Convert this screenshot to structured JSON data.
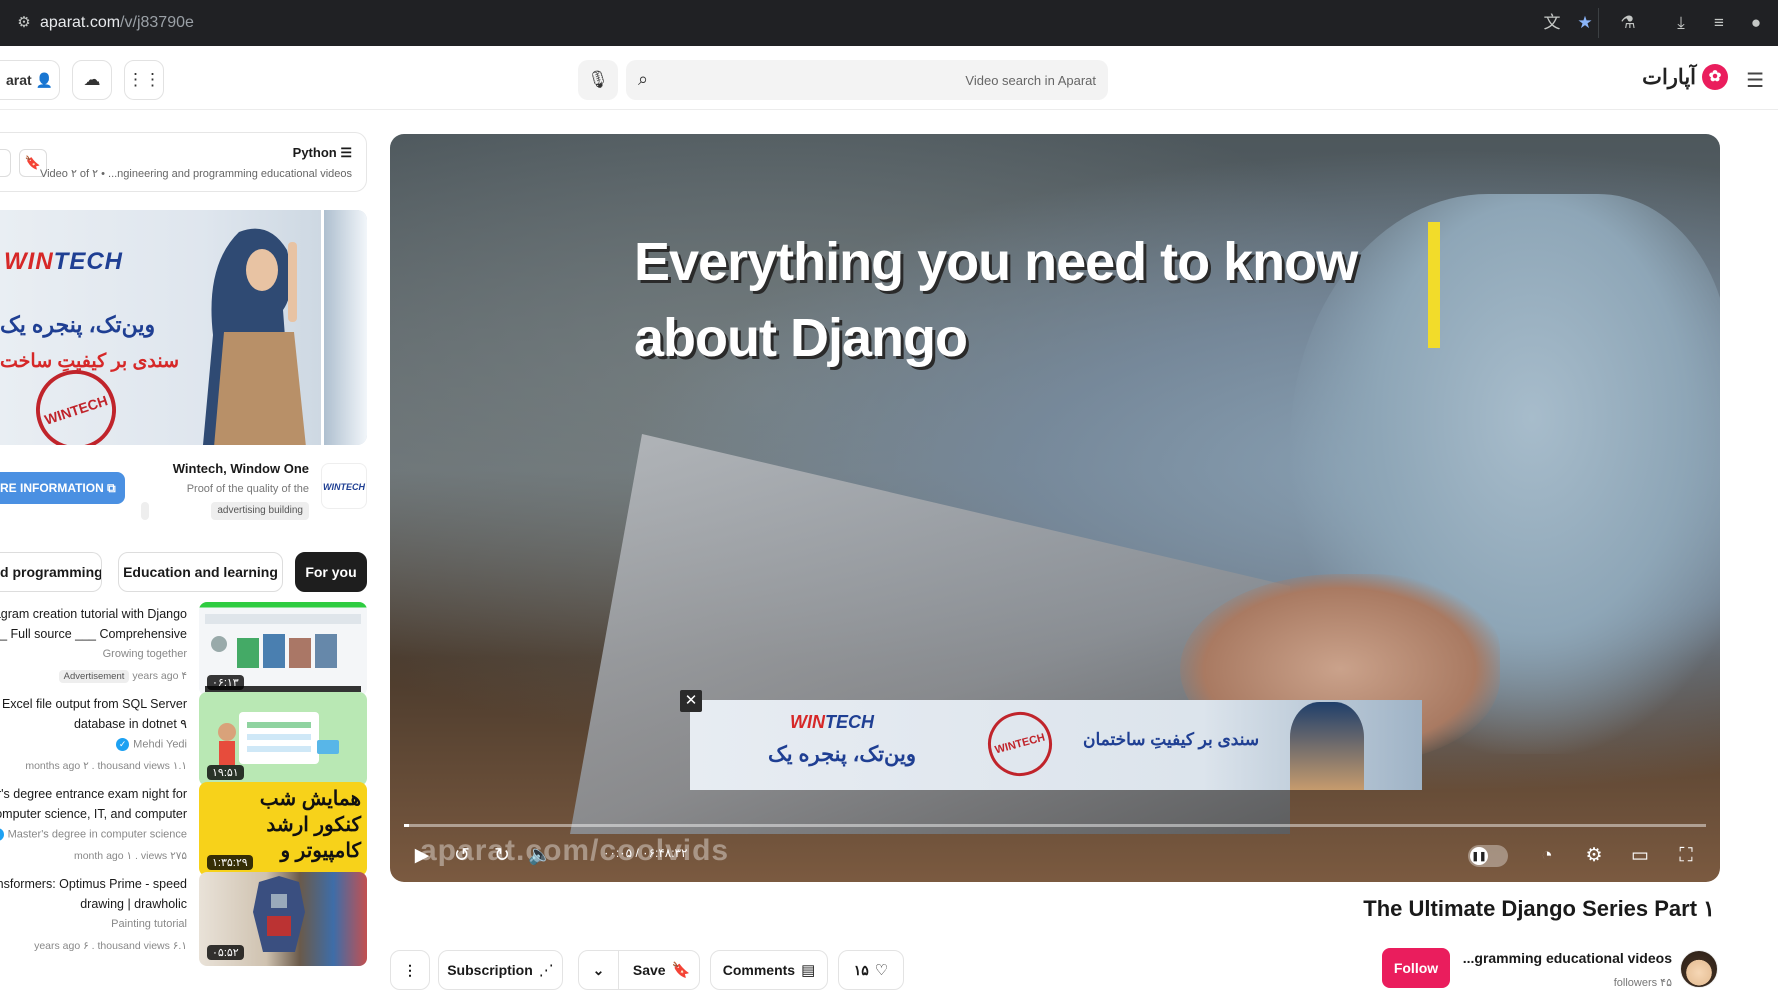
{
  "browser": {
    "url_host": "aparat.com",
    "url_path": "/v/j83790e"
  },
  "header": {
    "logo_text": "آپارات",
    "search_placeholder": "Video search in Aparat",
    "login_label": "arat"
  },
  "playlist": {
    "title": "Python",
    "subtitle": "Video ۲ of ۲  •  ...ngineering and programming educational videos"
  },
  "ad": {
    "brand_a": "WIN",
    "brand_b": "TECH",
    "fa_line1": "وین‌تک، پنجره یک",
    "fa_line2": "سندی بر کیفیتِ ساخت",
    "seal": "WINTECH",
    "title": "Wintech, Window One",
    "subtitle": "Proof of the quality of the",
    "tag": "advertising building",
    "more_label": "RE INFORMATION",
    "logo_text": "WINTECH"
  },
  "chips": [
    "d programming",
    "Education and learning",
    "For you"
  ],
  "videos": [
    {
      "line1": "agram creation tutorial with Django",
      "line2": "___ Full source ___ Comprehensive",
      "channel": "Growing together",
      "badge": "Advertisement",
      "meta": "years ago ۴",
      "duration": "۰۶:۱۳",
      "verified": false
    },
    {
      "line1": "Excel file output from SQL Server",
      "line2": "database in dotnet ۹",
      "channel": "Mehdi Yedi",
      "badge": "",
      "meta": "months ago ۲ .  thousand views ۱.۱",
      "duration": "۱۹:۵۱",
      "verified": true
    },
    {
      "line1": "er's degree entrance exam night for",
      "line2": "computer science, IT, and computer",
      "channel": "Master's degree in computer science",
      "badge": "",
      "meta": "month ago ۱ .  views ۲۷۵",
      "duration": "۱:۳۵:۲۹",
      "verified": true
    },
    {
      "line1": "ansformers: Optimus Prime - speed",
      "line2": "drawing | drawholic",
      "channel": "Painting tutorial",
      "badge": "",
      "meta": "years ago ۶ .  thousand views ۶.۱",
      "duration": "۰۵:۵۲",
      "verified": false
    }
  ],
  "thumb3_text": [
    "همایش شب",
    "کنکور ارشد",
    "کامپیوتر و"
  ],
  "player": {
    "title_line1": "Everything you need to know",
    "title_line2": "about Django",
    "watermark": "aparat.com/coolvids",
    "time": "۰۰:۰۵ / ۰۶:۴۸:۳۲",
    "progress": 0.002,
    "overlay_ad": {
      "brand_a": "WIN",
      "brand_b": "TECH",
      "line1": "وین‌تک، پنجره یک",
      "line2": "سندی بر کیفیتِ ساختمان",
      "seal": "WINTECH"
    }
  },
  "video": {
    "title": "The Ultimate Django Series Part ۱",
    "channel_name": "...gramming educational videos",
    "followers": "followers ۴۵",
    "follow_label": "Follow",
    "subscription_label": "Subscription",
    "save_label": "Save",
    "comments_label": "Comments",
    "likes": "۱۵"
  },
  "colors": {
    "accent": "#ea1d5d",
    "info_button": "#4a90e2",
    "chip_active": "#1e1e1e"
  }
}
